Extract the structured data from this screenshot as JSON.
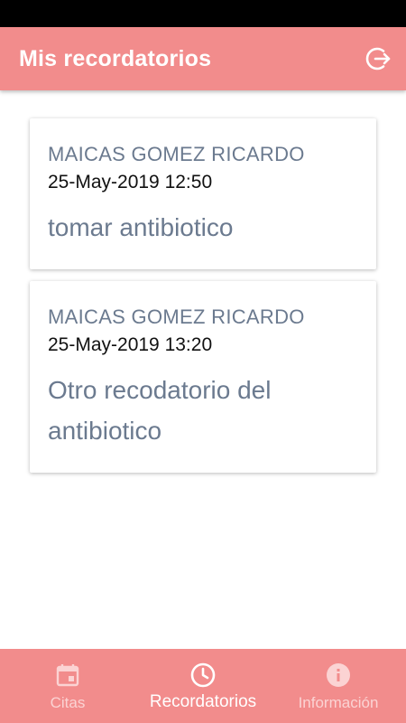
{
  "header": {
    "title": "Mis recordatorios",
    "logout_icon": "logout-icon"
  },
  "reminders": [
    {
      "name": "MAICAS GOMEZ RICARDO",
      "datetime": "25-May-2019 12:50",
      "text": "tomar antibiotico"
    },
    {
      "name": "MAICAS GOMEZ RICARDO",
      "datetime": "25-May-2019 13:20",
      "text": "Otro recodatorio del antibiotico"
    }
  ],
  "bottom_nav": {
    "items": [
      {
        "label": "Citas",
        "icon": "calendar-icon",
        "active": false
      },
      {
        "label": "Recordatorios",
        "icon": "clock-icon",
        "active": true
      },
      {
        "label": "Información",
        "icon": "info-icon",
        "active": false
      }
    ]
  },
  "colors": {
    "accent": "#f28c8c",
    "muted_text": "#6b7a8f",
    "status_bar": "#000000"
  }
}
